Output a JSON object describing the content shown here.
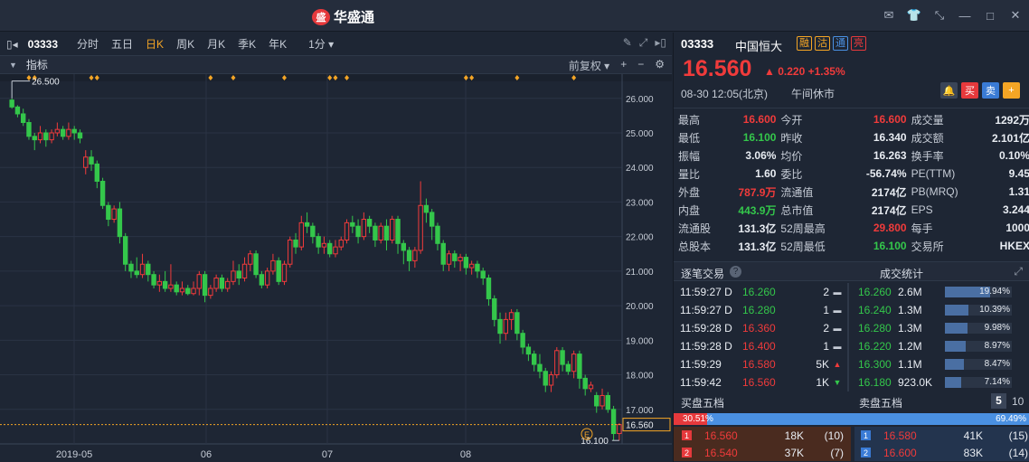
{
  "app": {
    "name": "华盛通",
    "logo_mark": "盛"
  },
  "window_buttons": [
    "mail-icon",
    "shirt-icon",
    "shrink-icon",
    "minimize-icon",
    "maximize-icon",
    "close-icon"
  ],
  "toolbar": {
    "code": "03333",
    "periods": [
      "分时",
      "五日",
      "日K",
      "周K",
      "月K",
      "季K",
      "年K"
    ],
    "active_period": "日K",
    "interval": "1分",
    "interval_arrow": "▾"
  },
  "indicator_bar": {
    "label": "指标",
    "adjust": "前复权",
    "adjust_arrow": "▾",
    "plus": "+",
    "minus": "−",
    "gear": "⚙"
  },
  "colors": {
    "up": "#f03b3b",
    "down": "#34c74b",
    "accent": "#f4a525",
    "bg": "#1e2634"
  },
  "chart_data": {
    "type": "candlestick",
    "y_ticks": [
      "26.000",
      "25.000",
      "24.000",
      "23.000",
      "22.000",
      "21.000",
      "20.000",
      "19.000",
      "18.000",
      "17.000"
    ],
    "ylim": [
      16.0,
      26.7
    ],
    "x_ticks": [
      "2019-05",
      "06",
      "07",
      "08"
    ],
    "high_label": "26.500",
    "low_label": "16.100",
    "last_label": "16.560",
    "event_marker": "E",
    "candles": [
      [
        25.95,
        25.75,
        26.0,
        25.7
      ],
      [
        25.75,
        25.55,
        25.8,
        25.45
      ],
      [
        25.55,
        25.3,
        25.7,
        25.2
      ],
      [
        25.3,
        24.9,
        25.4,
        24.8
      ],
      [
        24.9,
        24.8,
        25.0,
        24.5
      ],
      [
        24.8,
        25.0,
        25.2,
        24.7
      ],
      [
        25.0,
        24.8,
        25.1,
        24.6
      ],
      [
        24.8,
        25.0,
        25.1,
        24.7
      ],
      [
        25.0,
        25.1,
        25.3,
        24.9
      ],
      [
        25.1,
        24.9,
        25.2,
        24.8
      ],
      [
        24.9,
        25.1,
        25.3,
        24.8
      ],
      [
        25.1,
        25.0,
        25.2,
        24.8
      ],
      [
        25.0,
        24.85,
        25.1,
        24.7
      ],
      [
        24.0,
        24.3,
        24.5,
        23.8
      ],
      [
        24.3,
        24.1,
        24.5,
        23.9
      ],
      [
        24.1,
        23.6,
        24.2,
        23.4
      ],
      [
        23.6,
        22.9,
        23.7,
        22.8
      ],
      [
        22.9,
        22.5,
        23.0,
        22.3
      ],
      [
        22.5,
        22.8,
        22.9,
        22.4
      ],
      [
        22.8,
        22.0,
        23.0,
        21.8
      ],
      [
        22.0,
        21.2,
        22.1,
        21.0
      ],
      [
        21.2,
        21.0,
        21.3,
        20.8
      ],
      [
        21.0,
        20.9,
        21.4,
        20.8
      ],
      [
        20.9,
        21.2,
        21.5,
        20.8
      ],
      [
        21.2,
        20.9,
        21.3,
        20.7
      ],
      [
        20.9,
        20.6,
        21.0,
        20.5
      ],
      [
        20.6,
        20.7,
        20.9,
        20.4
      ],
      [
        20.7,
        20.5,
        21.0,
        20.4
      ],
      [
        20.5,
        20.6,
        21.2,
        20.4
      ],
      [
        20.6,
        20.4,
        20.7,
        20.3
      ],
      [
        20.4,
        20.5,
        20.7,
        20.3
      ],
      [
        20.5,
        20.35,
        20.6,
        20.3
      ],
      [
        20.35,
        20.5,
        20.7,
        20.3
      ],
      [
        20.5,
        20.9,
        21.0,
        20.3
      ],
      [
        20.9,
        20.3,
        21.0,
        20.1
      ],
      [
        20.3,
        20.5,
        20.6,
        20.2
      ],
      [
        20.5,
        20.8,
        20.9,
        20.4
      ],
      [
        20.8,
        20.5,
        20.9,
        20.4
      ],
      [
        20.5,
        20.7,
        20.8,
        20.4
      ],
      [
        20.7,
        21.0,
        21.3,
        20.6
      ],
      [
        21.0,
        20.8,
        21.2,
        20.6
      ],
      [
        20.8,
        21.2,
        21.4,
        20.7
      ],
      [
        21.2,
        21.5,
        21.6,
        21.0
      ],
      [
        21.5,
        20.9,
        21.6,
        20.8
      ],
      [
        20.9,
        20.6,
        21.0,
        20.5
      ],
      [
        20.6,
        21.0,
        21.1,
        20.5
      ],
      [
        21.0,
        21.3,
        21.5,
        20.9
      ],
      [
        21.3,
        20.7,
        21.4,
        20.6
      ],
      [
        20.7,
        21.2,
        21.3,
        20.6
      ],
      [
        21.2,
        21.9,
        22.0,
        21.1
      ],
      [
        21.9,
        21.7,
        22.1,
        21.5
      ],
      [
        21.7,
        22.4,
        22.6,
        21.6
      ],
      [
        22.4,
        22.3,
        22.7,
        22.1
      ],
      [
        22.3,
        22.0,
        22.4,
        21.8
      ],
      [
        22.0,
        21.7,
        22.1,
        21.5
      ],
      [
        21.7,
        21.8,
        22.0,
        21.5
      ],
      [
        21.8,
        21.5,
        21.9,
        21.4
      ],
      [
        21.5,
        21.7,
        21.9,
        21.4
      ],
      [
        21.7,
        21.9,
        22.0,
        21.6
      ],
      [
        21.9,
        22.4,
        22.5,
        21.8
      ],
      [
        22.4,
        22.3,
        22.6,
        22.1
      ],
      [
        22.3,
        22.0,
        22.5,
        21.8
      ],
      [
        22.0,
        22.5,
        22.7,
        21.9
      ],
      [
        22.5,
        22.3,
        22.6,
        22.1
      ],
      [
        22.3,
        21.9,
        22.4,
        21.7
      ],
      [
        21.9,
        22.3,
        22.4,
        21.8
      ],
      [
        22.3,
        21.9,
        22.5,
        21.6
      ],
      [
        21.9,
        22.5,
        22.6,
        21.8
      ],
      [
        22.5,
        21.8,
        22.6,
        21.5
      ],
      [
        21.8,
        21.6,
        21.9,
        21.2
      ],
      [
        21.6,
        21.3,
        21.7,
        21.0
      ],
      [
        21.3,
        21.6,
        21.7,
        21.1
      ],
      [
        21.6,
        22.9,
        23.6,
        21.5
      ],
      [
        22.9,
        22.7,
        23.1,
        22.4
      ],
      [
        22.7,
        22.3,
        22.8,
        21.9
      ],
      [
        22.3,
        21.8,
        22.4,
        21.6
      ],
      [
        21.8,
        21.2,
        21.9,
        21.0
      ],
      [
        21.2,
        21.5,
        21.6,
        21.0
      ],
      [
        21.5,
        21.3,
        21.6,
        21.1
      ],
      [
        21.3,
        21.4,
        21.5,
        21.0
      ],
      [
        21.4,
        21.1,
        21.5,
        20.9
      ],
      [
        21.1,
        21.2,
        21.3,
        20.9
      ],
      [
        21.2,
        21.0,
        21.3,
        20.8
      ],
      [
        21.0,
        20.8,
        21.1,
        20.6
      ],
      [
        20.8,
        20.2,
        20.9,
        20.0
      ],
      [
        20.2,
        19.6,
        20.3,
        19.4
      ],
      [
        19.6,
        19.2,
        19.8,
        18.9
      ],
      [
        19.2,
        19.6,
        19.8,
        19.0
      ],
      [
        19.6,
        19.8,
        19.9,
        19.3
      ],
      [
        19.8,
        19.2,
        19.9,
        19.0
      ],
      [
        19.2,
        18.8,
        19.3,
        18.6
      ],
      [
        18.8,
        18.6,
        18.9,
        18.4
      ],
      [
        18.6,
        18.3,
        18.7,
        18.1
      ],
      [
        18.3,
        18.1,
        18.6,
        17.9
      ],
      [
        18.1,
        17.7,
        18.2,
        17.5
      ],
      [
        17.7,
        18.0,
        18.1,
        17.5
      ],
      [
        18.0,
        18.7,
        18.8,
        17.9
      ],
      [
        18.7,
        18.3,
        18.8,
        18.1
      ],
      [
        18.3,
        18.1,
        18.4,
        18.0
      ],
      [
        18.1,
        18.6,
        18.7,
        17.9
      ],
      [
        18.6,
        17.9,
        18.7,
        17.6
      ],
      [
        17.9,
        17.6,
        18.0,
        17.4
      ],
      [
        17.6,
        17.7,
        17.8,
        17.5
      ],
      [
        17.4,
        17.1,
        17.5,
        16.9
      ],
      [
        17.1,
        17.4,
        17.6,
        17.0
      ],
      [
        17.4,
        17.0,
        17.5,
        16.9
      ],
      [
        17.0,
        16.3,
        17.1,
        16.1
      ],
      [
        16.3,
        16.56,
        16.6,
        16.1
      ]
    ],
    "markers": [
      3,
      4,
      14,
      15,
      35,
      39,
      48,
      56,
      57,
      59,
      80,
      81,
      89,
      99
    ]
  },
  "quote": {
    "code": "03333",
    "name": "中国恒大",
    "tags": [
      "融",
      "沽",
      "通",
      "亮"
    ],
    "price": "16.560",
    "arrow": "▲",
    "change": "0.220",
    "change_pct": "+1.35%",
    "datetime": "08-30  12:05(北京)",
    "status": "午间休市",
    "actions": {
      "bell": "🔔",
      "buy": "买",
      "sell": "卖",
      "add": "+"
    }
  },
  "stats": [
    [
      {
        "k": "最高",
        "v": "16.600",
        "c": "red"
      },
      {
        "k": "今开",
        "v": "16.600",
        "c": "red"
      },
      {
        "k": "成交量",
        "v": "1292万",
        "c": "white"
      }
    ],
    [
      {
        "k": "最低",
        "v": "16.100",
        "c": "green"
      },
      {
        "k": "昨收",
        "v": "16.340",
        "c": "white"
      },
      {
        "k": "成交额",
        "v": "2.101亿",
        "c": "white"
      }
    ],
    [
      {
        "k": "振幅",
        "v": "3.06%",
        "c": "white"
      },
      {
        "k": "均价",
        "v": "16.263",
        "c": "white"
      },
      {
        "k": "换手率",
        "v": "0.10%",
        "c": "white"
      }
    ],
    [
      {
        "k": "量比",
        "v": "1.60",
        "c": "white"
      },
      {
        "k": "委比",
        "v": "-56.74%",
        "c": "white"
      },
      {
        "k": "PE(TTM)",
        "v": "9.45",
        "c": "white"
      }
    ],
    [
      {
        "k": "外盘",
        "v": "787.9万",
        "c": "red"
      },
      {
        "k": "流通值",
        "v": "2174亿",
        "c": "white"
      },
      {
        "k": "PB(MRQ)",
        "v": "1.31",
        "c": "white"
      }
    ],
    [
      {
        "k": "内盘",
        "v": "443.9万",
        "c": "green"
      },
      {
        "k": "总市值",
        "v": "2174亿",
        "c": "white"
      },
      {
        "k": "EPS",
        "v": "3.244",
        "c": "white"
      }
    ],
    [
      {
        "k": "流通股",
        "v": "131.3亿",
        "c": "white"
      },
      {
        "k": "52周最高",
        "v": "29.800",
        "c": "red"
      },
      {
        "k": "每手",
        "v": "1000",
        "c": "white"
      }
    ],
    [
      {
        "k": "总股本",
        "v": "131.3亿",
        "c": "white"
      },
      {
        "k": "52周最低",
        "v": "16.100",
        "c": "green"
      },
      {
        "k": "交易所",
        "v": "HKEX",
        "c": "white"
      }
    ]
  ],
  "sections": {
    "trades": "逐笔交易",
    "help": "?",
    "deal_stats": "成交统计",
    "expand": "⤢",
    "bids": "买盘五档",
    "asks": "卖盘五档",
    "depth_5": "5",
    "depth_10": "10"
  },
  "trades": [
    {
      "t": "11:59:27 D",
      "p": "16.260",
      "pc": "green",
      "v": "2",
      "d": "flat"
    },
    {
      "t": "11:59:27 D",
      "p": "16.280",
      "pc": "green",
      "v": "1",
      "d": "flat"
    },
    {
      "t": "11:59:28 D",
      "p": "16.360",
      "pc": "red",
      "v": "2",
      "d": "flat"
    },
    {
      "t": "11:59:28 D",
      "p": "16.400",
      "pc": "red",
      "v": "1",
      "d": "flat"
    },
    {
      "t": "11:59:29",
      "p": "16.580",
      "pc": "red",
      "v": "5K",
      "d": "up"
    },
    {
      "t": "11:59:42",
      "p": "16.560",
      "pc": "red",
      "v": "1K",
      "d": "down"
    }
  ],
  "deal_stats": [
    {
      "p": "16.260",
      "v": "2.6M",
      "pct": "19.94%",
      "f": 0.1994
    },
    {
      "p": "16.240",
      "v": "1.3M",
      "pct": "10.39%",
      "f": 0.1039
    },
    {
      "p": "16.280",
      "v": "1.3M",
      "pct": "9.98%",
      "f": 0.0998
    },
    {
      "p": "16.220",
      "v": "1.2M",
      "pct": "8.97%",
      "f": 0.0897
    },
    {
      "p": "16.300",
      "v": "1.1M",
      "pct": "8.47%",
      "f": 0.0847
    },
    {
      "p": "16.180",
      "v": "923.0K",
      "pct": "7.14%",
      "f": 0.0714
    }
  ],
  "ratio": {
    "bid": "30.51%",
    "ask": "69.49%",
    "bid_f": 0.3051
  },
  "bids": [
    {
      "lv": "1",
      "p": "16.560",
      "v": "18K",
      "n": "(10)"
    },
    {
      "lv": "2",
      "p": "16.540",
      "v": "37K",
      "n": "(7)"
    }
  ],
  "asks": [
    {
      "lv": "1",
      "p": "16.580",
      "v": "41K",
      "n": "(15)"
    },
    {
      "lv": "2",
      "p": "16.600",
      "v": "83K",
      "n": "(14)"
    }
  ]
}
